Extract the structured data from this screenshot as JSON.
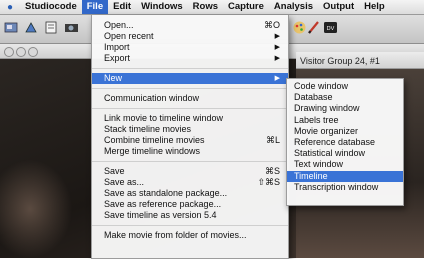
{
  "menubar": {
    "apple": "",
    "items": [
      "Studiocode",
      "File",
      "Edit",
      "Windows",
      "Rows",
      "Capture",
      "Analysis",
      "Output",
      "Help"
    ],
    "active_index": 1
  },
  "visitor_title": "Visitor Group  24, #1",
  "file_menu": {
    "group1": [
      {
        "label": "Open...",
        "shortcut": "⌘O"
      },
      {
        "label": "Open recent",
        "submenu": true
      },
      {
        "label": "Import",
        "submenu": true
      },
      {
        "label": "Export",
        "submenu": true
      }
    ],
    "new_item": {
      "label": "New",
      "submenu": true
    },
    "group2": [
      {
        "label": "Communication window"
      }
    ],
    "group3": [
      {
        "label": "Link movie to timeline window"
      },
      {
        "label": "Stack timeline movies"
      },
      {
        "label": "Combine timeline movies",
        "shortcut": "⌘L"
      },
      {
        "label": "Merge timeline windows"
      }
    ],
    "group4": [
      {
        "label": "Save",
        "shortcut": "⌘S"
      },
      {
        "label": "Save as...",
        "shortcut": "⇧⌘S"
      },
      {
        "label": "Save as standalone package..."
      },
      {
        "label": "Save as reference package..."
      },
      {
        "label": "Save timeline as version 5.4"
      }
    ],
    "group5": [
      {
        "label": "Make movie from folder of movies..."
      }
    ]
  },
  "new_submenu": {
    "items": [
      "Code window",
      "Database",
      "Drawing window",
      "Labels tree",
      "Movie organizer",
      "Reference database",
      "Statistical window",
      "Text window",
      "Timeline",
      "Transcription window"
    ],
    "highlight_index": 8
  },
  "toolbar": {
    "icons": [
      "tool-icon-1",
      "tool-icon-2",
      "tool-icon-3",
      "tool-icon-4",
      "palette-icon",
      "pen-icon",
      "dv-icon"
    ]
  }
}
